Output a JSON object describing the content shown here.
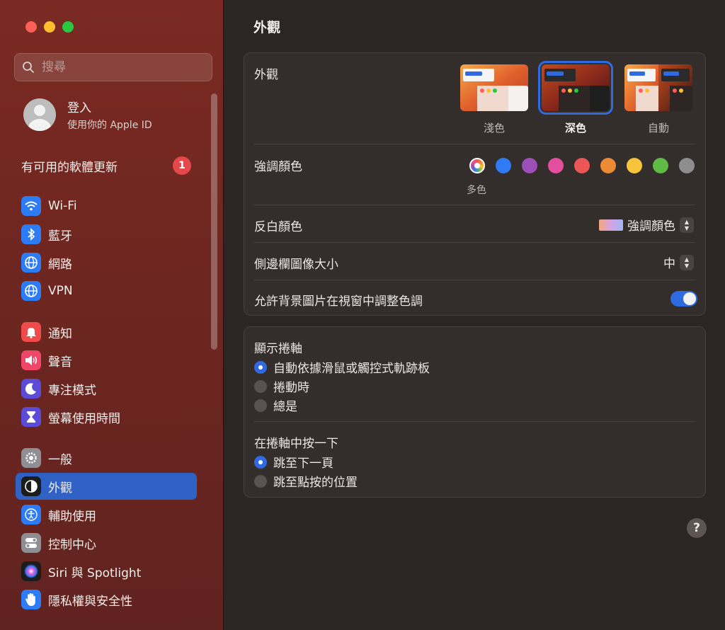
{
  "sidebar": {
    "search_placeholder": "搜尋",
    "account": {
      "title": "登入",
      "subtitle": "使用你的 Apple ID"
    },
    "update": {
      "label": "有可用的軟體更新",
      "badge": "1"
    },
    "items": [
      {
        "label": "Wi-Fi",
        "icon": "wifi-icon",
        "color": "#2d7cf6"
      },
      {
        "label": "藍牙",
        "icon": "bluetooth-icon",
        "color": "#2d7cf6"
      },
      {
        "label": "網路",
        "icon": "globe-icon",
        "color": "#2d7cf6"
      },
      {
        "label": "VPN",
        "icon": "vpn-globe-icon",
        "color": "#2d7cf6"
      },
      {
        "label": "通知",
        "icon": "bell-icon",
        "color": "#f04a4a"
      },
      {
        "label": "聲音",
        "icon": "speaker-icon",
        "color": "#f0466a"
      },
      {
        "label": "專注模式",
        "icon": "moon-icon",
        "color": "#5b4bd6"
      },
      {
        "label": "螢幕使用時間",
        "icon": "hourglass-icon",
        "color": "#5b4bd6"
      },
      {
        "label": "一般",
        "icon": "gear-icon",
        "color": "#8e8e93"
      },
      {
        "label": "外觀",
        "icon": "appearance-icon",
        "color": "#1c1c1e",
        "selected": true
      },
      {
        "label": "輔助使用",
        "icon": "accessibility-icon",
        "color": "#2d7cf6"
      },
      {
        "label": "控制中心",
        "icon": "toggles-icon",
        "color": "#8e8e93"
      },
      {
        "label": "Siri 與 Spotlight",
        "icon": "siri-icon",
        "color": "#1c1c1e"
      },
      {
        "label": "隱私權與安全性",
        "icon": "hand-icon",
        "color": "#2d7cf6"
      }
    ]
  },
  "main": {
    "title": "外觀",
    "appearance": {
      "label": "外觀",
      "options": [
        {
          "label": "淺色",
          "selected": false
        },
        {
          "label": "深色",
          "selected": true
        },
        {
          "label": "自動",
          "selected": false
        }
      ]
    },
    "accent": {
      "label": "強調顏色",
      "colors": [
        "multicolor",
        "#2f7bf5",
        "#9d4fb8",
        "#e34f9c",
        "#ec5656",
        "#ec8b34",
        "#f7c43c",
        "#5fbb46",
        "#8e8e8e"
      ],
      "selected_label": "多色"
    },
    "highlight": {
      "label": "反白顏色",
      "value": "強調顏色"
    },
    "sidebar_icon_size": {
      "label": "側邊欄圖像大小",
      "value": "中"
    },
    "wallpaper_tinting": {
      "label": "允許背景圖片在視窗中調整色調",
      "on": true
    },
    "scrollbars": {
      "label": "顯示捲軸",
      "options": [
        "自動依據滑鼠或觸控式軌跡板",
        "捲動時",
        "總是"
      ],
      "selected": 0
    },
    "click_scrollbar": {
      "label": "在捲軸中按一下",
      "options": [
        "跳至下一頁",
        "跳至點按的位置"
      ],
      "selected": 0
    },
    "help": "?"
  }
}
